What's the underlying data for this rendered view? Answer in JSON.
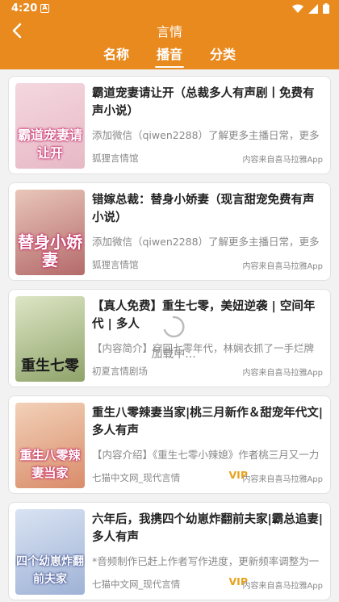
{
  "status": {
    "time": "4:20",
    "notif_letter": "A"
  },
  "header": {
    "title": "言情"
  },
  "tabs": [
    {
      "label": "名称",
      "active": false
    },
    {
      "label": "播音",
      "active": true
    },
    {
      "label": "分类",
      "active": false
    }
  ],
  "items": [
    {
      "title": "霸道宠妻请让开（总裁多人有声剧丨免费有声小说）",
      "desc": "添加微信（qiwen2288）了解更多主播日常，更多",
      "source": "狐狸言情馆",
      "from": "内容来自喜马拉雅App",
      "vip": "",
      "cover_text": "霸道宠妻请让开",
      "cover_colors": [
        "#f4d7df",
        "#e7b8c6"
      ]
    },
    {
      "title": "错嫁总裁：替身小娇妻（现言甜宠免费有声小说）",
      "desc": "添加微信（qiwen2288）了解更多主播日常，更多",
      "source": "狐狸言情馆",
      "from": "内容来自喜马拉雅App",
      "vip": "",
      "cover_text": "替身小娇妻",
      "cover_colors": [
        "#e9c6b9",
        "#b46a6a"
      ]
    },
    {
      "title": "【真人免费】重生七零，美妞逆袭 | 空间年代 | 多人",
      "desc": "【内容简介】穿回七零年代，林娴衣抓了一手烂牌",
      "source": "初夏言情剧场",
      "from": "内容来自喜马拉雅App",
      "vip": "",
      "cover_text": "重生七零",
      "cover_colors": [
        "#dde6c5",
        "#8fa36a"
      ]
    },
    {
      "title": "重生八零辣妻当家|桃三月新作＆甜宠年代文|多人有声",
      "desc": "【内容介绍】《重生七零小辣媳》作者桃三月又一力",
      "source": "七猫中文网_现代言情",
      "from": "内容来自喜马拉雅App",
      "vip": "VIP",
      "cover_text": "重生八零辣妻当家",
      "cover_colors": [
        "#f2d1b8",
        "#d98c6a"
      ]
    },
    {
      "title": "六年后，我携四个幼崽炸翻前夫家|霸总追妻|多人有声",
      "desc": "*音频制作已赶上作者写作进度，更新频率调整为一",
      "source": "七猫中文网_现代言情",
      "from": "内容来自喜马拉雅App",
      "vip": "VIP",
      "cover_text": "四个幼崽炸翻前夫家",
      "cover_colors": [
        "#d9e3f2",
        "#9fb2d6"
      ]
    }
  ],
  "loading": {
    "text": "加载中..."
  },
  "colors": {
    "accent": "#e98a1f",
    "vip": "#e8a21d"
  }
}
